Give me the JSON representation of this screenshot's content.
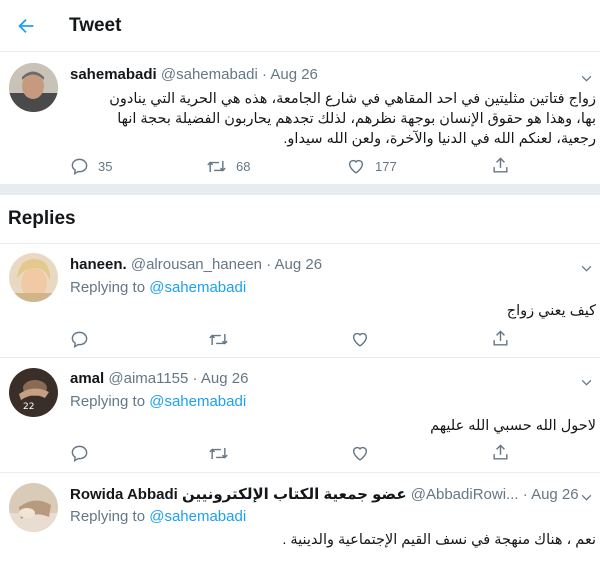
{
  "header": {
    "title": "Tweet"
  },
  "main_tweet": {
    "name": "sahemabadi",
    "handle": "@sahemabadi",
    "dot": "·",
    "date": "Aug 26",
    "lines": [
      "زواج فتاتين مثليتين في احد المقاهي في شارع الجامعة، هذه هي الحرية التي ينادون",
      "بها، وهذا هو حقوق الإنسان بوجهة نظرهم، لذلك تجدهم يحاربون الفضيلة بحجة انها",
      "رجعية، لعنكم الله في الدنيا والآخرة، ولعن الله سيداو."
    ],
    "replies_count": "35",
    "retweets_count": "68",
    "likes_count": "177"
  },
  "replies_heading": "Replies",
  "replies": [
    {
      "name": "haneen.",
      "handle": "@alrousan_haneen",
      "dot": "·",
      "date": "Aug 26",
      "replying_prefix": "Replying to",
      "replying_to": "@sahemabadi",
      "text": "كيف يعني زواج"
    },
    {
      "name": "amal",
      "handle": "@aima1155",
      "dot": "·",
      "date": "Aug 26",
      "replying_prefix": "Replying to",
      "replying_to": "@sahemabadi",
      "text": "لاحول الله حسبي الله عليهم"
    },
    {
      "name": "Rowida Abbadi عضو جمعية الكتاب الإلكترونيين",
      "handle": "@AbbadiRowi...",
      "dot": "·",
      "date": "Aug 26",
      "replying_prefix": "Replying to",
      "replying_to": "@sahemabadi",
      "text": "نعم ، هناك منهجة في نسف القيم الإجتماعية والدينية ."
    }
  ],
  "icons": {
    "back": "arrow-left-icon",
    "caret": "chevron-down-icon",
    "reply": "comment-icon",
    "retweet": "retweet-icon",
    "like": "heart-icon",
    "share": "share-icon"
  },
  "colors": {
    "accent": "#1da1f2",
    "muted": "#657786",
    "text": "#14171a",
    "divider": "#e6ecf0"
  }
}
